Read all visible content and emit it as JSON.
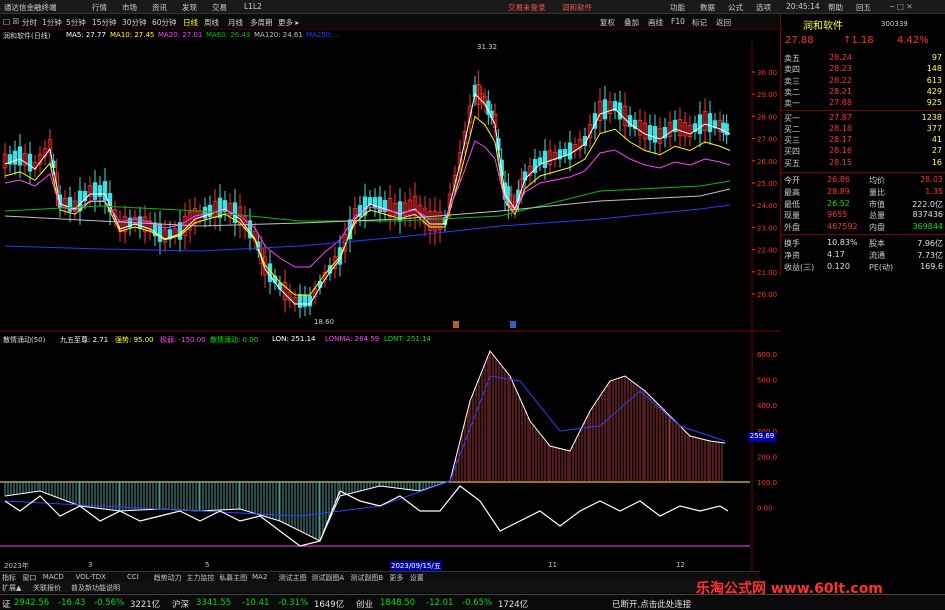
{
  "menu": {
    "app": "通达信金融终端",
    "items": [
      "行情",
      "市场",
      "资讯",
      "发现",
      "交易",
      "L1L2"
    ],
    "center_links": [
      "交易未登录",
      "润和软件"
    ],
    "right": [
      "功能",
      "数据",
      "公式",
      "选项"
    ],
    "time": "20:45:14",
    "win_btns": [
      "帮助",
      "回五"
    ]
  },
  "toolbar": {
    "left": [
      "□ ☒",
      "分时",
      "1分钟",
      "5分钟",
      "15分钟",
      "30分钟",
      "60分钟",
      "日线",
      "周线",
      "月线",
      "多周期",
      "更多 ▸"
    ],
    "active": "日线",
    "right": [
      "复权",
      "叠加",
      "画线",
      "F10",
      "标记",
      "返回"
    ]
  },
  "kline_header": {
    "title": "润和软件(日线)",
    "ma5": "MA5: 27.77",
    "ma10": "MA10: 27.45",
    "ma20": "MA20: 27.01",
    "ma60": "MA60: 26.43",
    "ma120": "MA120: 24.61",
    "ma250": "MA250:..."
  },
  "price_axis": [
    "30.00",
    "29.00",
    "28.00",
    "27.00",
    "26.00",
    "25.00",
    "24.00",
    "23.00",
    "22.00",
    "21.00",
    "20.00"
  ],
  "annotations": {
    "high": "31.32",
    "low": "18.60"
  },
  "ind_header": {
    "name": "散情涌动(50)",
    "jwzs": "九五至尊: 2.71",
    "qs": "强势: 95.00",
    "jr": "极弱: -150.00",
    "sq": "散情涌动: 0.00",
    "lon": "LON: 251.14",
    "lonma": "LONMA: 264.59",
    "lont": "LONT: 251.14"
  },
  "ind_axis": [
    "600.0",
    "500.0",
    "400.0",
    "300.0",
    "200.0",
    "100.0",
    "0.00"
  ],
  "ind_value": "259.69",
  "date_axis": {
    "year": "2023年",
    "m1": "3",
    "m2": "5",
    "cursor": "2023/09/15/五",
    "m3": "11",
    "m4": "12"
  },
  "stock": {
    "name": "润和软件",
    "code": "300339",
    "price": "27.88",
    "change": "↑1.18",
    "pct": "4.42%"
  },
  "order_book": [
    {
      "label": "卖五",
      "price": "28.24",
      "vol": "97",
      "color": "red"
    },
    {
      "label": "卖四",
      "price": "28.23",
      "vol": "148",
      "color": "red"
    },
    {
      "label": "卖三",
      "price": "28.22",
      "vol": "613",
      "color": "red"
    },
    {
      "label": "卖二",
      "price": "28.21",
      "vol": "429",
      "color": "red"
    },
    {
      "label": "卖一",
      "price": "27.88",
      "vol": "925",
      "color": "red"
    },
    {
      "label": "买一",
      "price": "27.87",
      "vol": "1238",
      "color": "red"
    },
    {
      "label": "买二",
      "price": "28.18",
      "vol": "377",
      "color": "red"
    },
    {
      "label": "买三",
      "price": "28.17",
      "vol": "41",
      "color": "red"
    },
    {
      "label": "买四",
      "price": "28.16",
      "vol": "27",
      "color": "red"
    },
    {
      "label": "买五",
      "price": "28.15",
      "vol": "16",
      "color": "red"
    }
  ],
  "quote_rows": [
    {
      "l1": "今开",
      "v1": "26.86",
      "l2": "均价",
      "v2": "28.03",
      "c1": "red",
      "c2": "red"
    },
    {
      "l1": "最高",
      "v1": "28.89",
      "l2": "量比",
      "v2": "1.35",
      "c1": "red",
      "c2": "red"
    },
    {
      "l1": "最低",
      "v1": "26.52",
      "l2": "市值",
      "v2": "222.0亿",
      "c1": "grn",
      "c2": "wht"
    },
    {
      "l1": "现量",
      "v1": "9655",
      "l2": "总量",
      "v2": "837436",
      "c1": "red",
      "c2": "wht"
    },
    {
      "l1": "外盘",
      "v1": "467592",
      "l2": "内盘",
      "v2": "369844",
      "c1": "red",
      "c2": "grn"
    },
    {
      "l1": "换手",
      "v1": "10.83%",
      "l2": "股本",
      "v2": "7.96亿",
      "c1": "wht",
      "c2": "wht"
    },
    {
      "l1": "净资",
      "v1": "4.17",
      "l2": "流通",
      "v2": "7.73亿",
      "c1": "wht",
      "c2": "wht"
    },
    {
      "l1": "收益(三)",
      "v1": "0.120",
      "l2": "PE(动)",
      "v2": "169.6",
      "c1": "wht",
      "c2": "wht"
    }
  ],
  "tabs": [
    "指标",
    "窗口",
    "MACD",
    "VOL-TDX",
    "CCI",
    "趋势动力",
    "主力监控",
    "私募主图",
    "MA2",
    "测试主图",
    "测试副图A",
    "测试副图B",
    "更多",
    "设置"
  ],
  "tabs2": [
    "扩展▲",
    "关联报价",
    "普及新功能说明"
  ],
  "status": [
    {
      "t": "证",
      "c": "wht"
    },
    {
      "t": "2942.56",
      "c": "grn"
    },
    {
      "t": "-16.43",
      "c": "grn"
    },
    {
      "t": "-0.56%",
      "c": "grn"
    },
    {
      "t": "3221亿",
      "c": "wht"
    },
    {
      "t": "沪深",
      "c": "wht"
    },
    {
      "t": "3341.55",
      "c": "grn"
    },
    {
      "t": "-10.41",
      "c": "grn"
    },
    {
      "t": "-0.31%",
      "c": "grn"
    },
    {
      "t": "1649亿",
      "c": "wht"
    },
    {
      "t": "创业",
      "c": "wht"
    },
    {
      "t": "1848.50",
      "c": "grn"
    },
    {
      "t": "-12.01",
      "c": "grn"
    },
    {
      "t": "-0.65%",
      "c": "grn"
    },
    {
      "t": "1724亿",
      "c": "wht"
    },
    {
      "t": "已断开,点击此处连接",
      "c": "wht"
    }
  ],
  "watermark": "乐淘公式网 www.60lt.com",
  "colors": {
    "up": "#ff3030",
    "down": "#40e0e0",
    "ma5": "#ffffff",
    "ma10": "#ffff00",
    "ma20": "#ff40ff",
    "ma60": "#00c000",
    "ma120": "#c0c0c0",
    "ma250": "#2040ff"
  }
}
